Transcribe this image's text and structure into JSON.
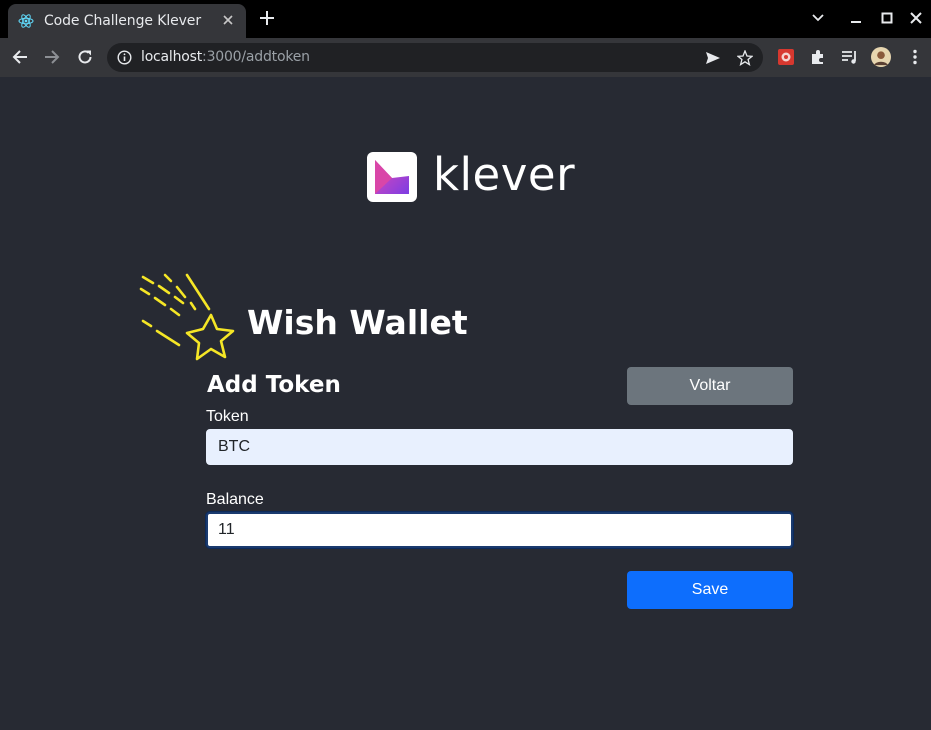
{
  "browser": {
    "tab_title": "Code Challenge Klever",
    "url_host": "localhost",
    "url_path": ":3000/addtoken"
  },
  "page": {
    "logo_text": "klever",
    "wallet_title": "Wish Wallet",
    "form_title": "Add Token",
    "back_button": "Voltar",
    "token_label": "Token",
    "token_value": "BTC",
    "balance_label": "Balance",
    "balance_value": "11",
    "save_button": "Save"
  },
  "colors": {
    "page_bg": "#272a33",
    "primary": "#0d6efd",
    "secondary": "#6c757d",
    "star_yellow": "#f5e626",
    "logo_gradient_start": "#e44ab4",
    "logo_gradient_end": "#7c3de3"
  }
}
